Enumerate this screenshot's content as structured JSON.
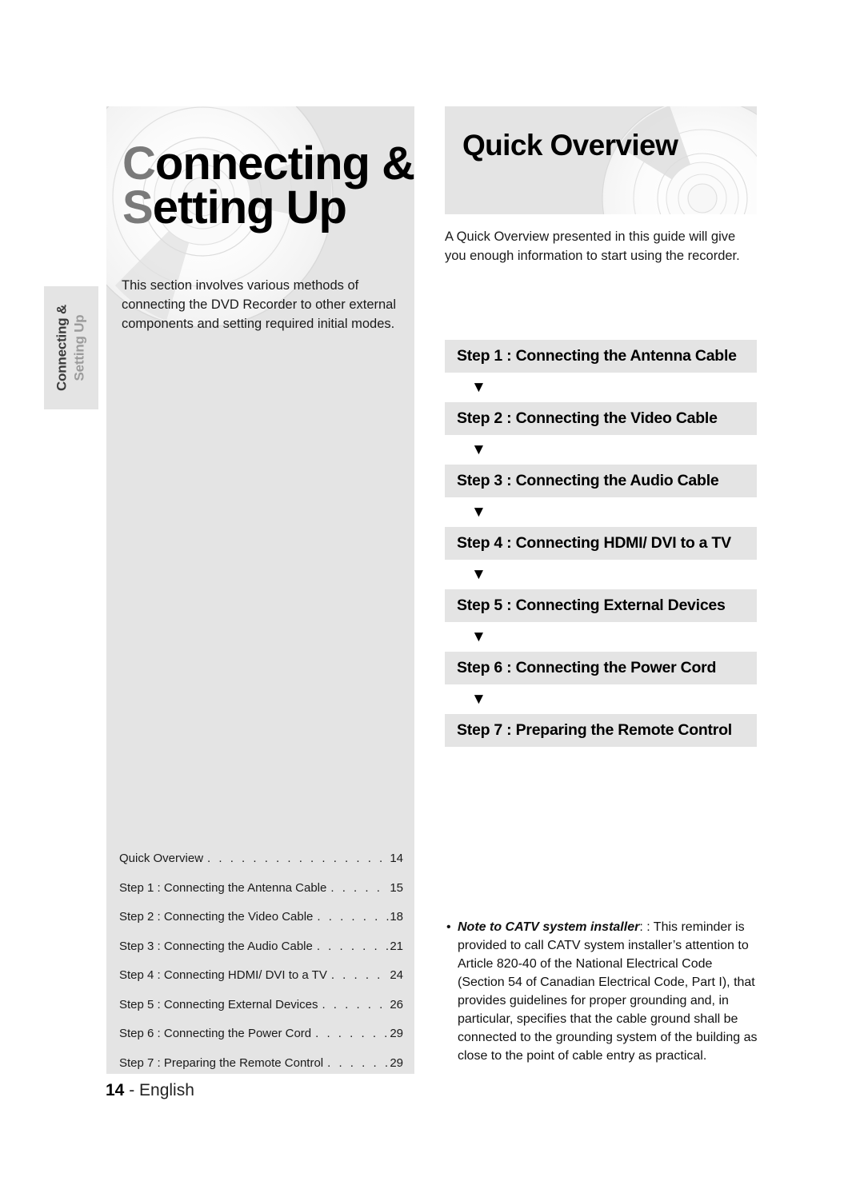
{
  "side_tab": {
    "line1": "Connecting &",
    "line2": "Setting Up"
  },
  "left_panel": {
    "title_line1": "Connecting &",
    "title_line2": "Setting Up",
    "description": "This section involves various methods of connecting the DVD Recorder to other external components and setting required initial modes.",
    "toc_dots": ". . . . . . . . . . . . . . . . . . . . . . . . . . . . . . . . . . . . . . . . . . . . . . . . . .",
    "toc": [
      {
        "label": "Quick Overview",
        "page": "14"
      },
      {
        "label": "Step 1 : Connecting the Antenna Cable",
        "page": "15"
      },
      {
        "label": "Step 2 : Connecting the Video Cable",
        "page": "18"
      },
      {
        "label": "Step 3 : Connecting the Audio Cable",
        "page": "21"
      },
      {
        "label": "Step 4 : Connecting HDMI/ DVI to a TV",
        "page": "24"
      },
      {
        "label": "Step 5 : Connecting External Devices",
        "page": "26"
      },
      {
        "label": "Step 6 : Connecting the Power Cord",
        "page": "29"
      },
      {
        "label": "Step 7 : Preparing the Remote Control",
        "page": "29"
      }
    ]
  },
  "footer": {
    "page_number": "14",
    "separator": " - ",
    "language": "English"
  },
  "right_panel": {
    "heading": "Quick Overview",
    "description": "A Quick Overview presented in this guide will give you enough information to start using the recorder.",
    "arrow_glyph": "▼",
    "steps": [
      "Step 1 : Connecting the Antenna Cable",
      "Step 2 : Connecting the Video Cable",
      "Step 3 : Connecting the Audio Cable",
      "Step 4 : Connecting HDMI/ DVI to a TV",
      "Step 5 : Connecting External Devices",
      "Step 6 : Connecting the Power Cord",
      "Step 7 : Preparing the Remote Control"
    ],
    "note": {
      "bullet": "•",
      "lead": "Note to CATV system installer",
      "body": ": : This reminder is provided to call CATV system installer’s attention to Article 820-40 of the National Electrical Code (Section 54 of Canadian Electrical Code, Part I), that provides guidelines for proper grounding and, in particular, specifies that the cable ground shall be connected to the grounding system of the building as close to the point of cable entry as practical."
    }
  },
  "colors": {
    "panel_gray": "#e4e4e4",
    "title_gray": "#7a7a7a",
    "text_black": "#000000",
    "page_background": "#ffffff"
  }
}
